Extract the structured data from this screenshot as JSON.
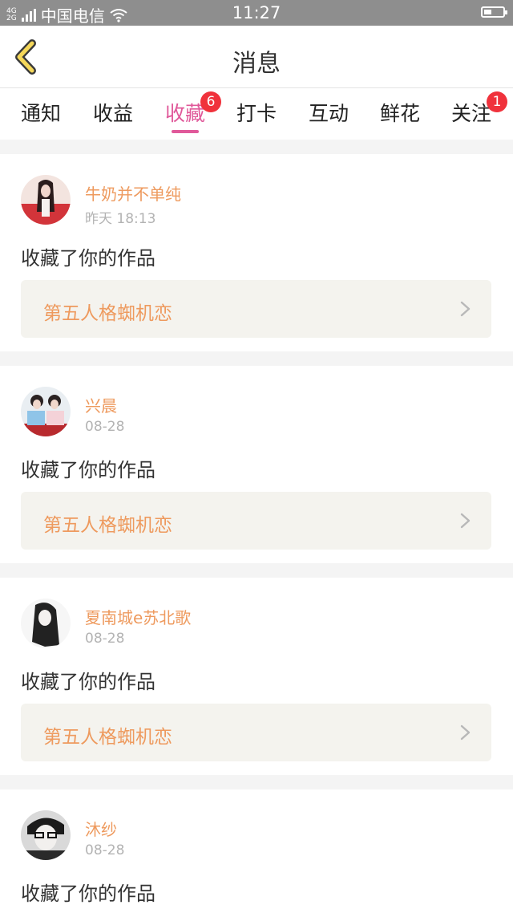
{
  "status_bar": {
    "net_top": "4G",
    "net_bottom": "2G",
    "carrier": "中国电信",
    "time": "11:27"
  },
  "header": {
    "title": "消息"
  },
  "tabs": [
    {
      "label": "通知",
      "badge": ""
    },
    {
      "label": "收益",
      "badge": ""
    },
    {
      "label": "收藏",
      "badge": "6",
      "active": true
    },
    {
      "label": "打卡",
      "badge": ""
    },
    {
      "label": "互动",
      "badge": ""
    },
    {
      "label": "鲜花",
      "badge": ""
    },
    {
      "label": "关注",
      "badge": "1"
    }
  ],
  "messages": [
    {
      "user": "牛奶并不单纯",
      "time": "昨天 18:13",
      "action": "收藏了你的作品",
      "work": "第五人格蜘机恋"
    },
    {
      "user": "兴晨",
      "time": "08-28",
      "action": "收藏了你的作品",
      "work": "第五人格蜘机恋"
    },
    {
      "user": "夏南城e苏北歌",
      "time": "08-28",
      "action": "收藏了你的作品",
      "work": "第五人格蜘机恋"
    },
    {
      "user": "沐纱",
      "time": "08-28",
      "action": "收藏了你的作品"
    }
  ],
  "colors": {
    "accent": "#e0599a",
    "badge": "#f0323c",
    "name": "#ee9a5e",
    "back_arrow": "#f5d85a"
  }
}
